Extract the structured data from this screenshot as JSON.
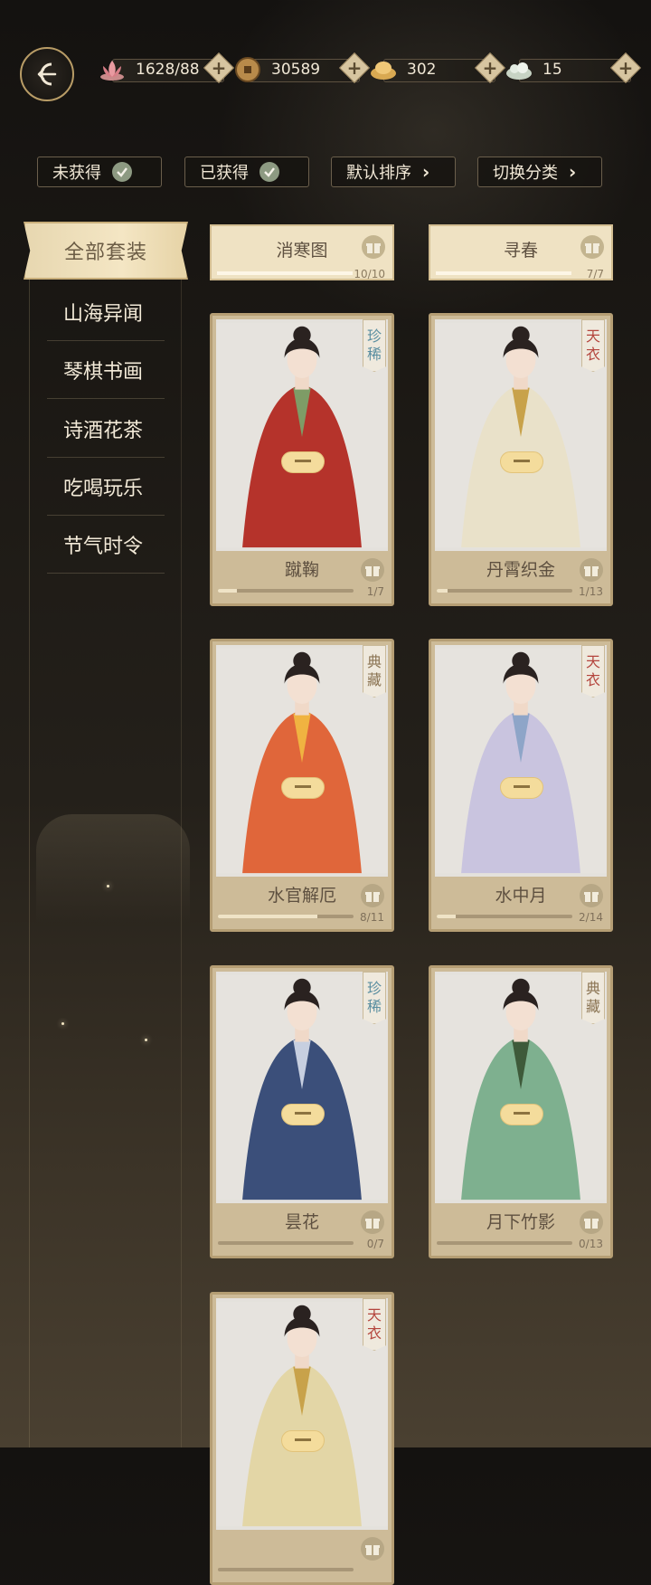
{
  "resources": [
    {
      "icon": "lotus-icon",
      "value": "1628/88"
    },
    {
      "icon": "coin-icon",
      "value": "30589"
    },
    {
      "icon": "ingot-icon",
      "value": "302"
    },
    {
      "icon": "jade-icon",
      "value": "15"
    }
  ],
  "filters": {
    "unobtained": "未获得",
    "obtained": "已获得",
    "sort": "默认排序",
    "switch": "切换分类"
  },
  "categories": {
    "active": "全部套装",
    "items": [
      "山海异闻",
      "琴棋书画",
      "诗酒花茶",
      "吃喝玩乐",
      "节气时令"
    ]
  },
  "top_cards": [
    {
      "name": "消寒图",
      "progress": "10/10",
      "fill": 1.0
    },
    {
      "name": "寻春",
      "progress": "7/7",
      "fill": 1.0
    }
  ],
  "cards": [
    {
      "name": "蹴鞠",
      "progress": "1/7",
      "fill": 0.14,
      "tag": [
        "珍",
        "稀"
      ],
      "tag_color": "#5a8ea0",
      "dress": "#b5332b",
      "accent": "#7e9c66"
    },
    {
      "name": "丹霄织金",
      "progress": "1/13",
      "fill": 0.08,
      "tag": [
        "天",
        "衣"
      ],
      "tag_color": "#b4453d",
      "dress": "#e9e1c9",
      "accent": "#c8a24a"
    },
    {
      "name": "水官解厄",
      "progress": "8/11",
      "fill": 0.73,
      "tag": [
        "典",
        "藏"
      ],
      "tag_color": "#8a7352",
      "dress": "#e0663a",
      "accent": "#f0b341"
    },
    {
      "name": "水中月",
      "progress": "2/14",
      "fill": 0.14,
      "tag": [
        "天",
        "衣"
      ],
      "tag_color": "#b4453d",
      "dress": "#c9c4df",
      "accent": "#8ea5c8"
    },
    {
      "name": "昙花",
      "progress": "0/7",
      "fill": 0.0,
      "tag": [
        "珍",
        "稀"
      ],
      "tag_color": "#5a8ea0",
      "dress": "#3b4f7a",
      "accent": "#c7cfe0"
    },
    {
      "name": "月下竹影",
      "progress": "0/13",
      "fill": 0.0,
      "tag": [
        "典",
        "藏"
      ],
      "tag_color": "#8a7352",
      "dress": "#7eb08f",
      "accent": "#3e5a3a"
    },
    {
      "name": "",
      "progress": "",
      "fill": 0.0,
      "tag": [
        "天",
        "衣"
      ],
      "tag_color": "#b4453d",
      "dress": "#e3d6a6",
      "accent": "#c8a24a"
    }
  ]
}
